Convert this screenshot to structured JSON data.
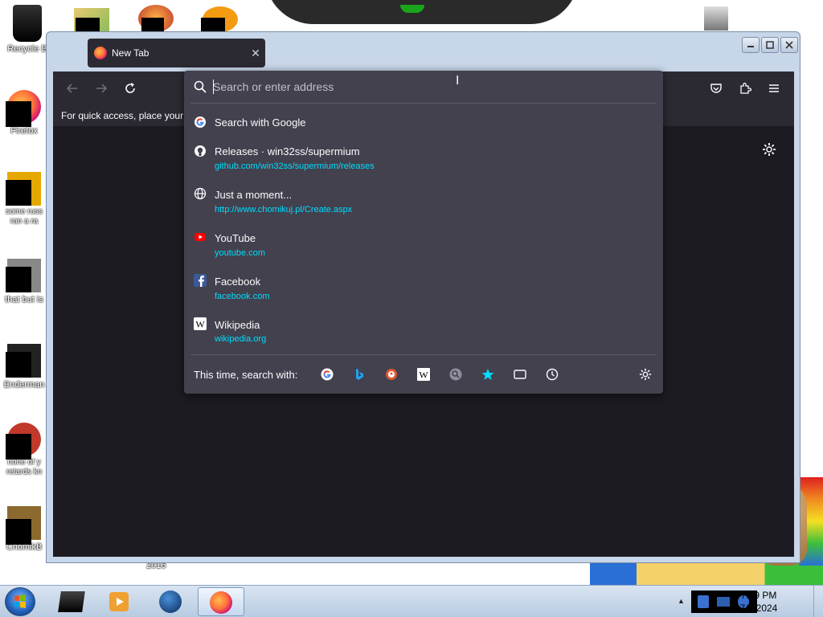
{
  "desktop": {
    "icons": [
      {
        "label": "Recycle B"
      },
      {
        "label": "Firefox"
      },
      {
        "label": "some russ ran a ra"
      },
      {
        "label": "that but is"
      },
      {
        "label": "Enderman"
      },
      {
        "label": "none of y retards kn"
      },
      {
        "label": "ChomikB"
      }
    ],
    "year_label": "2016"
  },
  "browser": {
    "tab_title": "New Tab",
    "bookmarks_text": "For quick access, place your l",
    "urlbar": {
      "placeholder": "Search or enter address",
      "search_with_google": "Search with Google",
      "results": [
        {
          "title": "Releases · win32ss/supermium",
          "url": "github.com/win32ss/supermium/releases",
          "icon": "github-icon"
        },
        {
          "title": "Just a moment...",
          "url": "http://www.chomikuj.pl/Create.aspx",
          "icon": "globe-icon"
        },
        {
          "title": "YouTube",
          "url": "youtube.com",
          "icon": "youtube-icon"
        },
        {
          "title": "Facebook",
          "url": "facebook.com",
          "icon": "facebook-icon"
        },
        {
          "title": "Wikipedia",
          "url": "wikipedia.org",
          "icon": "wikipedia-icon"
        }
      ],
      "search_with_label": "This time, search with:",
      "engines": [
        "google",
        "bing",
        "duckduckgo",
        "wikipedia",
        "search",
        "bookmarks",
        "tabs",
        "history"
      ]
    }
  },
  "taskbar": {
    "time": "7:59 PM",
    "date": "7/7/2024"
  },
  "colors": {
    "url_link": "#00ddff",
    "panel_bg": "#42414d",
    "toolbar_bg": "#2b2a33",
    "page_bg": "#1c1b22"
  }
}
